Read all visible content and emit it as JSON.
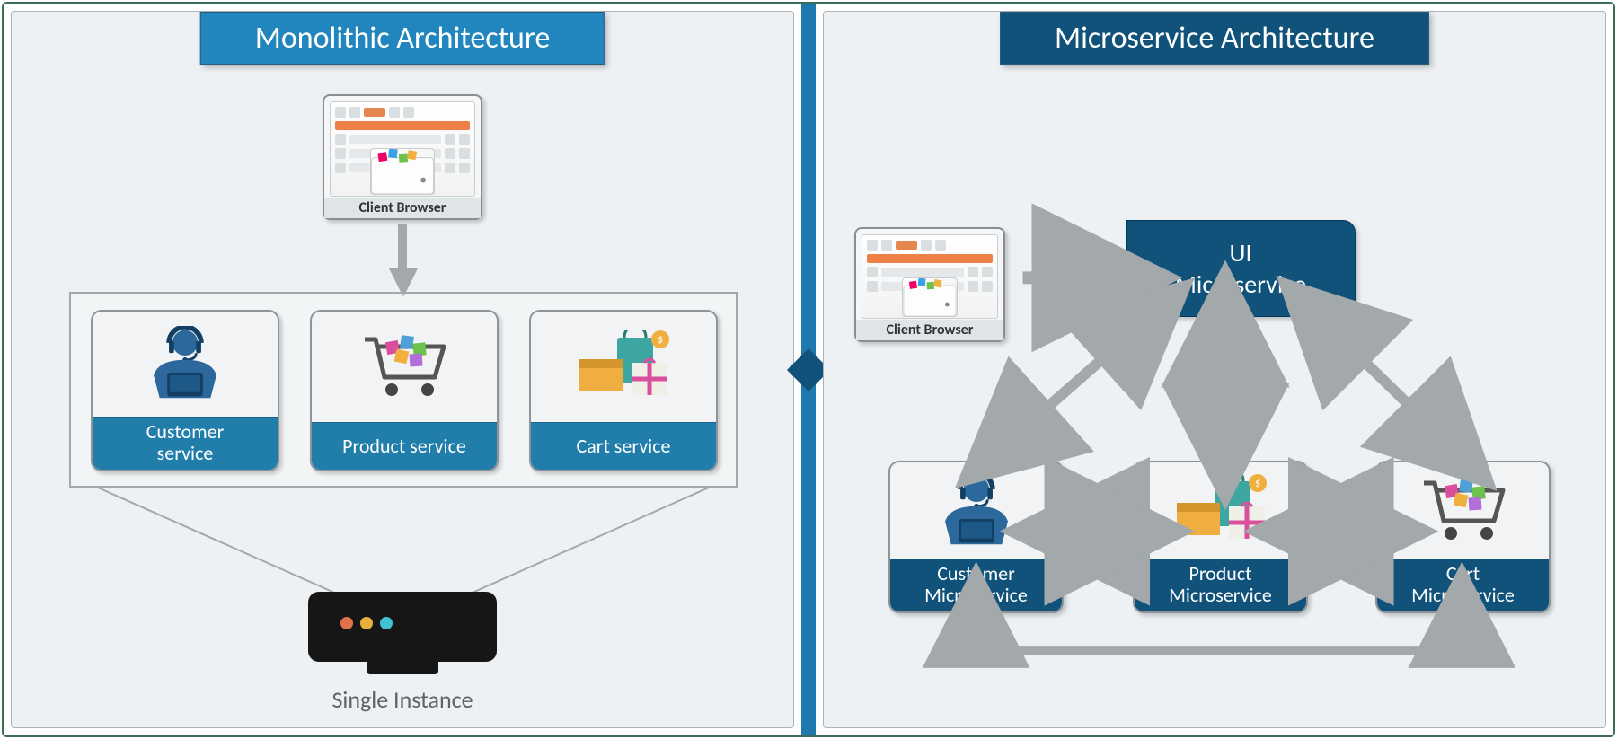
{
  "left": {
    "title": "Monolithic Architecture",
    "client_browser_label": "Client Browser",
    "services": [
      {
        "label": "Customer\nservice",
        "icon": "support"
      },
      {
        "label": "Product service",
        "icon": "cart"
      },
      {
        "label": "Cart service",
        "icon": "bags"
      }
    ],
    "bottom_label": "Single Instance"
  },
  "right": {
    "title": "Microservice Architecture",
    "client_browser_label": "Client Browser",
    "ui_ms": "UI\nMicroservice",
    "services": [
      {
        "label": "Customer\nMicroservice",
        "icon": "support"
      },
      {
        "label": "Product\nMicroservice",
        "icon": "bags"
      },
      {
        "label": "Cart\nMicroservice",
        "icon": "cart"
      }
    ]
  },
  "colors": {
    "title_light": "#2086bd",
    "title_dark": "#10527a",
    "panel_bg": "#edf1f3",
    "arrow": "#a3a8ab"
  }
}
